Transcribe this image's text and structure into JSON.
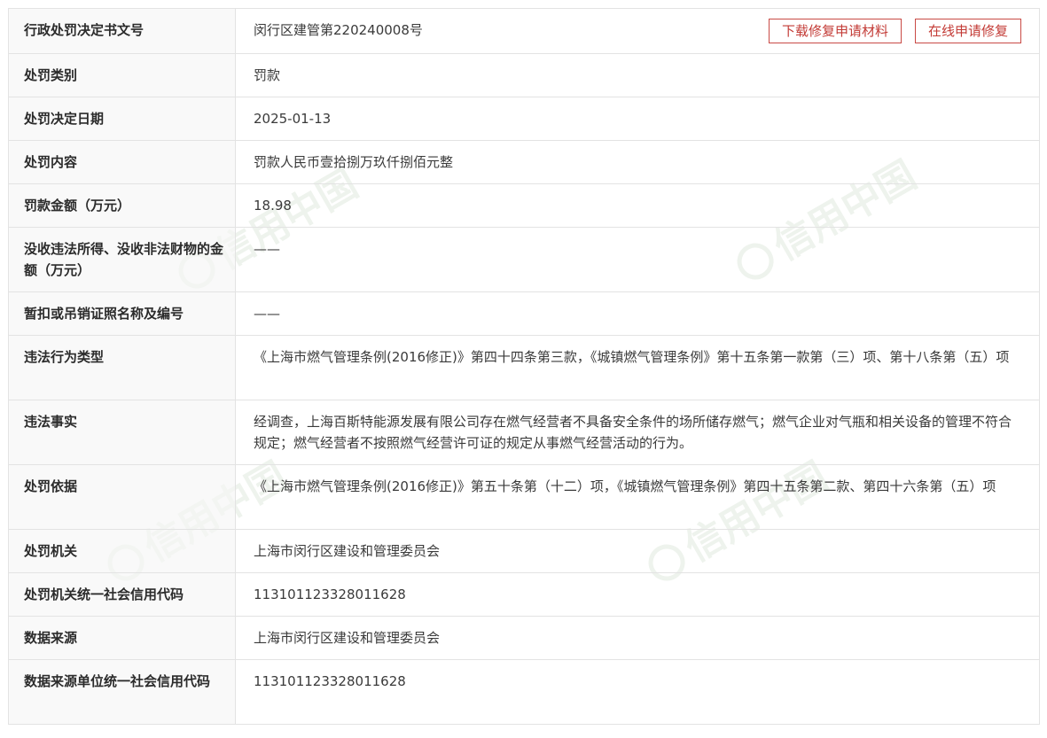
{
  "buttons": {
    "download": "下载修复申请材料",
    "online_repair": "在线申请修复"
  },
  "watermark": "信用中国",
  "rows": [
    {
      "label": "行政处罚决定书文号",
      "value": "闵行区建管第220240008号"
    },
    {
      "label": "处罚类别",
      "value": "罚款"
    },
    {
      "label": "处罚决定日期",
      "value": "2025-01-13"
    },
    {
      "label": "处罚内容",
      "value": "罚款人民币壹拾捌万玖仟捌佰元整"
    },
    {
      "label": "罚款金额（万元）",
      "value": "18.98"
    },
    {
      "label": "没收违法所得、没收非法财物的金额（万元）",
      "value": "——"
    },
    {
      "label": "暂扣或吊销证照名称及编号",
      "value": "——"
    },
    {
      "label": "违法行为类型",
      "value": "《上海市燃气管理条例(2016修正)》第四十四条第三款，《城镇燃气管理条例》第十五条第一款第（三）项、第十八条第（五）项"
    },
    {
      "label": "违法事实",
      "value": "经调查，上海百斯特能源发展有限公司存在燃气经营者不具备安全条件的场所储存燃气；燃气企业对气瓶和相关设备的管理不符合规定；燃气经营者不按照燃气经营许可证的规定从事燃气经营活动的行为。"
    },
    {
      "label": "处罚依据",
      "value": "《上海市燃气管理条例(2016修正)》第五十条第（十二）项，《城镇燃气管理条例》第四十五条第二款、第四十六条第（五）项"
    },
    {
      "label": "处罚机关",
      "value": "上海市闵行区建设和管理委员会"
    },
    {
      "label": "处罚机关统一社会信用代码",
      "value": "113101123328011628"
    },
    {
      "label": "数据来源",
      "value": "上海市闵行区建设和管理委员会"
    },
    {
      "label": "数据来源单位统一社会信用代码",
      "value": "113101123328011628"
    }
  ]
}
